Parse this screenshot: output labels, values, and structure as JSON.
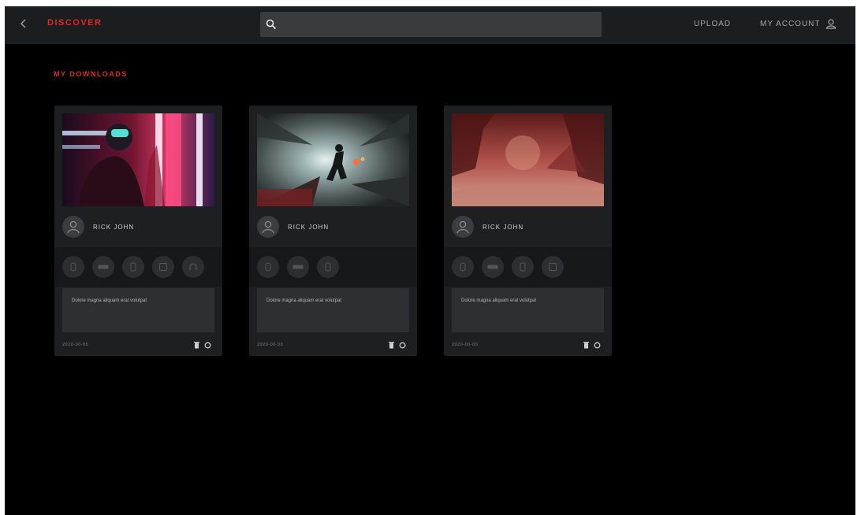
{
  "header": {
    "back_icon": "chevron-left-icon",
    "brand": "DISCOVER",
    "search": {
      "placeholder": "",
      "icon": "search-icon"
    },
    "upload_label": "UPLOAD",
    "account_label": "MY ACCOUNT",
    "account_icon": "user-icon"
  },
  "page": {
    "title": "MY DOWNLOADS"
  },
  "cards": [
    {
      "thumbnail": "neon-helmet-figure-image",
      "author": "RICK JOHN",
      "description": "Dolore magna aliquam erat volutpat",
      "date": "2020-00-00",
      "gear_icons": [
        "mouse-icon",
        "keyboard-icon",
        "controller-icon",
        "monitor-icon",
        "headset-icon"
      ]
    },
    {
      "thumbnail": "soldier-explosion-image",
      "author": "RICK JOHN",
      "description": "Dolore magna aliquam erat volutpat",
      "date": "2020-00-00",
      "gear_icons": [
        "mouse-icon",
        "keyboard-icon",
        "controller-icon"
      ]
    },
    {
      "thumbnail": "red-ruins-landscape-image",
      "author": "RICK JOHN",
      "description": "Dolore magna aliquam erat volutpat",
      "date": "2020-00-00",
      "gear_icons": [
        "mouse-icon",
        "keyboard-icon",
        "controller-icon",
        "monitor-icon"
      ]
    }
  ],
  "colors": {
    "accent": "#e3262c",
    "background": "#000000",
    "card": "#1e1f21",
    "topbar": "#1c1d1f"
  }
}
